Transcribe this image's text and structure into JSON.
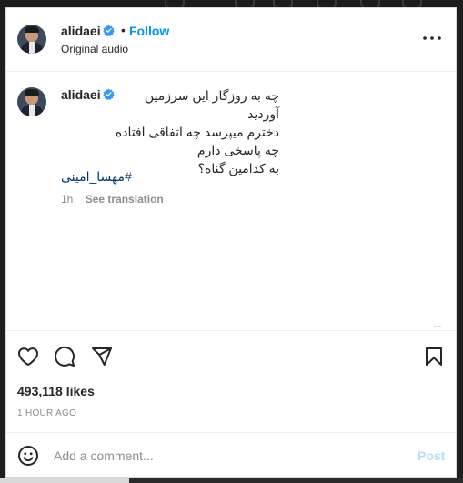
{
  "header": {
    "username": "alidaei",
    "separator": "•",
    "follow_label": "Follow",
    "subtitle": "Original audio"
  },
  "caption": {
    "username": "alidaei",
    "lines": [
      "چه به روزگار این سرزمین آوردید",
      "دخترم میپرسد چه اتفاقی افتاده",
      "چه پاسخی دارم",
      "به کدامین گناه؟"
    ],
    "hashtag": "#مهسا_امینی",
    "time": "1h",
    "translate_label": "See translation",
    "more_marker": "--"
  },
  "actions": {
    "likes": "493,118 likes",
    "timestamp": "1 HOUR AGO"
  },
  "comment": {
    "placeholder": "Add a comment...",
    "post_label": "Post"
  },
  "colors": {
    "accent": "#0095f6",
    "hashtag": "#00376b",
    "muted": "#8e8e8e",
    "post_disabled": "#b2dffc",
    "verified": "#3897f0"
  },
  "icons": {
    "header": [
      "verified-badge-icon",
      "more-options-icon"
    ],
    "actions": [
      "heart-icon",
      "comment-icon",
      "share-icon",
      "bookmark-icon"
    ],
    "comment": [
      "emoji-icon"
    ]
  }
}
